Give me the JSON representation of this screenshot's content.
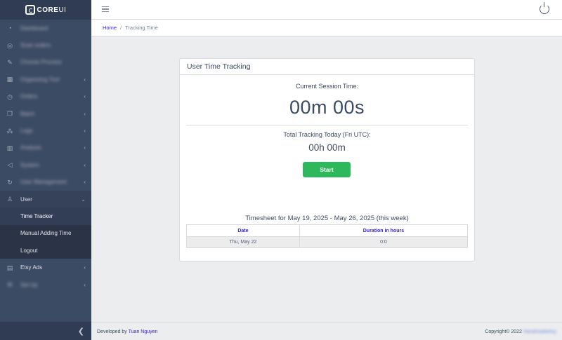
{
  "brand": {
    "name": "CORE",
    "suffix": "UI"
  },
  "sidebar": {
    "items": [
      {
        "label": "Dashboard",
        "icon": "speedometer-icon",
        "blur": true,
        "chevron": false
      },
      {
        "label": "Scan orders",
        "icon": "target-icon",
        "blur": true,
        "chevron": false
      },
      {
        "label": "Choose Process",
        "icon": "pen-icon",
        "blur": true,
        "chevron": false
      },
      {
        "label": "Organizing Tool",
        "icon": "grid-icon",
        "blur": true,
        "chevron": true
      },
      {
        "label": "Orders",
        "icon": "clock-icon",
        "blur": true,
        "chevron": true
      },
      {
        "label": "Batch",
        "icon": "layers-icon",
        "blur": true,
        "chevron": true
      },
      {
        "label": "Logs",
        "icon": "network-icon",
        "blur": true,
        "chevron": true
      },
      {
        "label": "Analysis",
        "icon": "bar-chart-icon",
        "blur": true,
        "chevron": true
      },
      {
        "label": "System",
        "icon": "sound-icon",
        "blur": true,
        "chevron": true
      },
      {
        "label": "User Management",
        "icon": "history-icon",
        "blur": true,
        "chevron": true
      },
      {
        "label": "User",
        "icon": "user-icon",
        "blur": false,
        "chevron": true,
        "open": true
      }
    ],
    "user_sub": [
      "Time Tracker",
      "Manual Adding Time",
      "Logout"
    ],
    "after": [
      {
        "label": "Etsy Ads",
        "icon": "ads-icon",
        "blur": false,
        "chevron": true
      },
      {
        "label": "Set Up",
        "icon": "settings-icon",
        "blur": true,
        "chevron": true
      }
    ]
  },
  "breadcrumb": {
    "home": "Home",
    "separator": "/",
    "current": "Tracking Time"
  },
  "card": {
    "title": "User Time Tracking",
    "session_label": "Current Session Time:",
    "session_value": "00m 00s",
    "total_label": "Total Tracking Today (Fri UTC):",
    "total_value": "00h 00m",
    "start_label": "Start",
    "timesheet_title": "Timesheet for May 19, 2025 - May 26, 2025 (this week)",
    "table": {
      "headers": [
        "Date",
        "Duration in hours"
      ],
      "rows": [
        [
          "Thu, May 22",
          "0:0"
        ]
      ]
    }
  },
  "footer": {
    "prefix": "Developed by",
    "developer": "Tuan Nguyen",
    "copyright": "Copyright© 2022",
    "company": "Handmadeetsy"
  },
  "colors": {
    "sidebar": "#3c4b64",
    "accent": "#321fdb",
    "success": "#2eb85c"
  }
}
